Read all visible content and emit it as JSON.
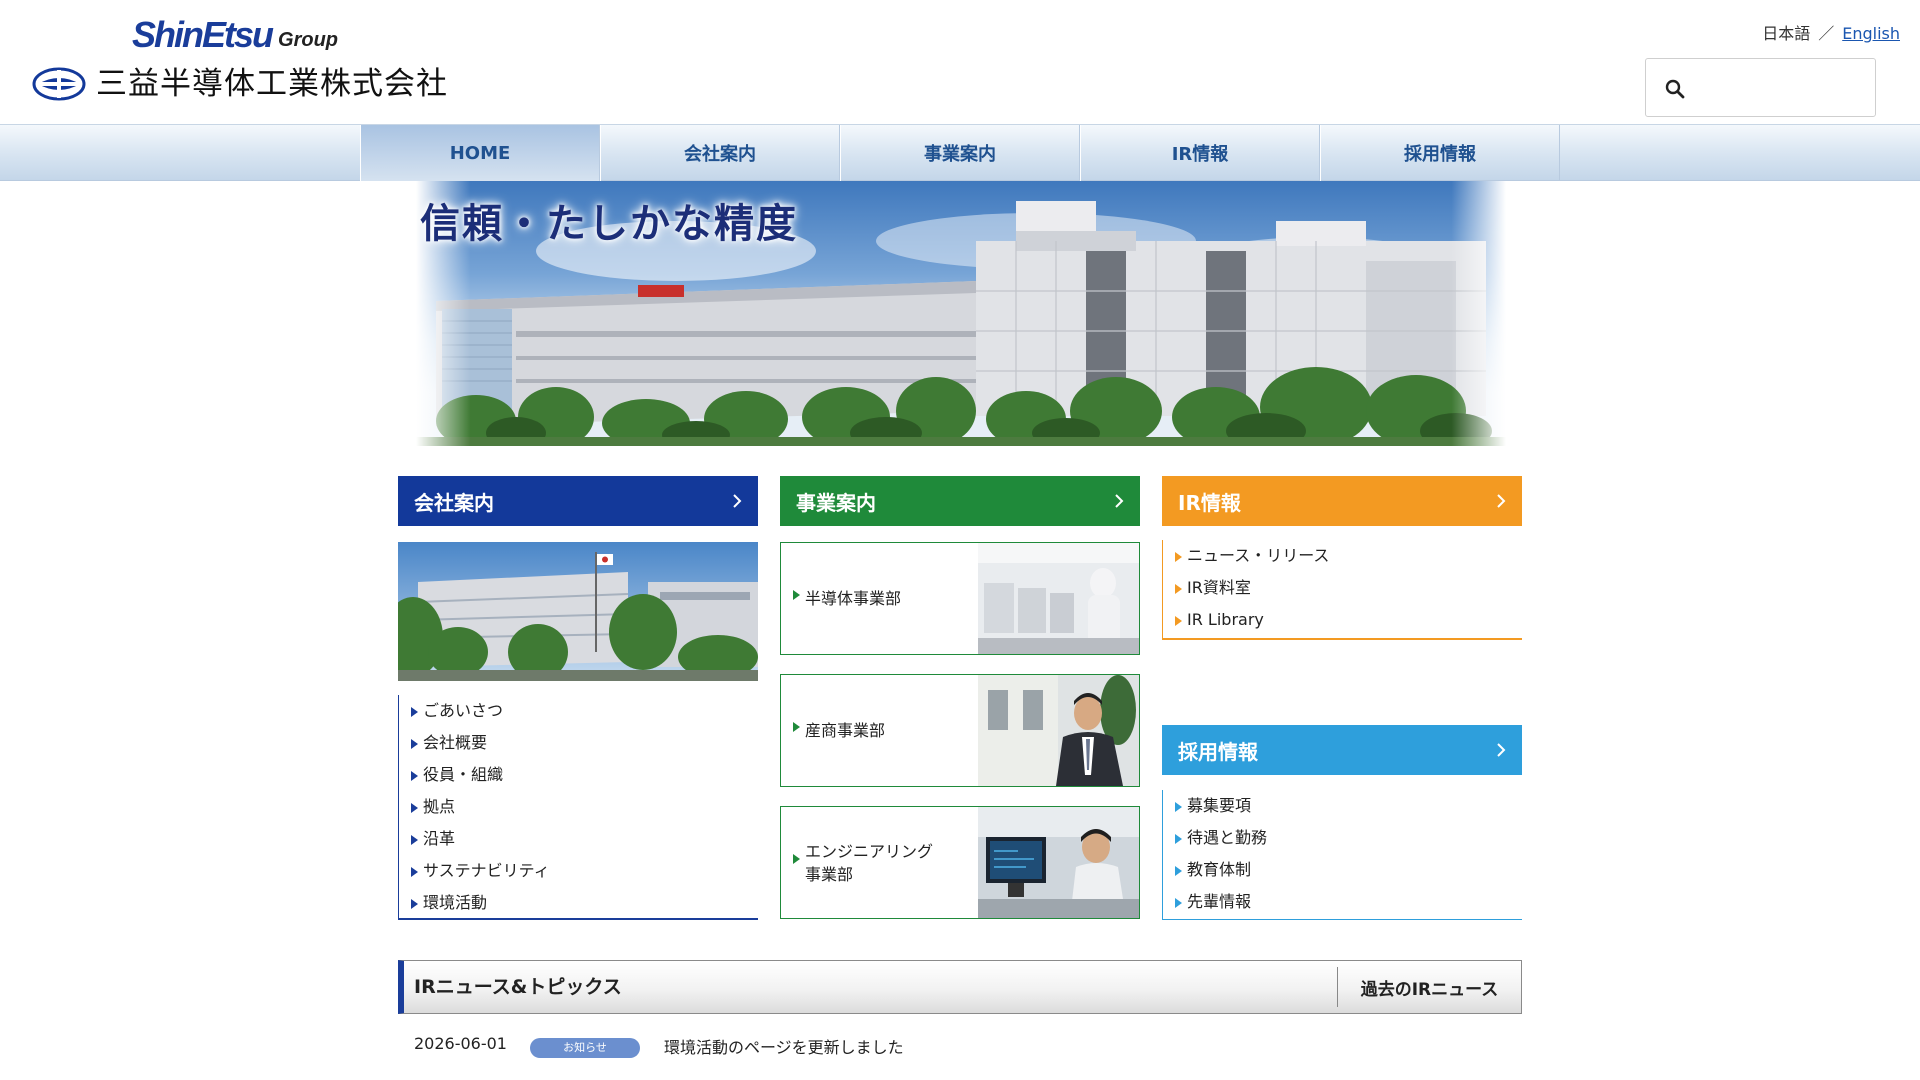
{
  "header": {
    "group_logo_main": "ShinEtsu",
    "group_logo_suffix": "Group",
    "company_name": "三益半導体工業株式会社",
    "lang_current": "日本語",
    "lang_separator": "／",
    "lang_english": "English",
    "search_placeholder": ""
  },
  "nav": {
    "items": [
      {
        "label": "HOME",
        "active": true
      },
      {
        "label": "会社案内"
      },
      {
        "label": "事業案内"
      },
      {
        "label": "IR情報"
      },
      {
        "label": "採用情報"
      }
    ]
  },
  "hero": {
    "title": "信頼・たしかな精度"
  },
  "company": {
    "heading": "会社案内",
    "items": [
      "ごあいさつ",
      "会社概要",
      "役員・組織",
      "拠点",
      "沿革",
      "サステナビリティ",
      "環境活動"
    ]
  },
  "business": {
    "heading": "事業案内",
    "cards": [
      {
        "line1": "半導体事業部",
        "line2": ""
      },
      {
        "line1": "産商事業部",
        "line2": ""
      },
      {
        "line1": "エンジニアリング",
        "line2": "事業部"
      }
    ]
  },
  "ir": {
    "heading": "IR情報",
    "items": [
      "ニュース・リリース",
      "IR資料室",
      "IR Library"
    ]
  },
  "recruit": {
    "heading": "採用情報",
    "items": [
      "募集要項",
      "待遇と勤務",
      "教育体制",
      "先輩情報"
    ]
  },
  "news": {
    "title": "IRニュース&トピックス",
    "past_link": "過去のIRニュース",
    "entries": [
      {
        "date": "2026-06-01",
        "badge": "お知らせ",
        "text": "環境活動のページを更新しました"
      }
    ]
  },
  "colors": {
    "company": "#13399a",
    "business": "#1f8a3a",
    "ir": "#f39a22",
    "recruit": "#2e9fdc",
    "nav_text": "#1f5190"
  }
}
